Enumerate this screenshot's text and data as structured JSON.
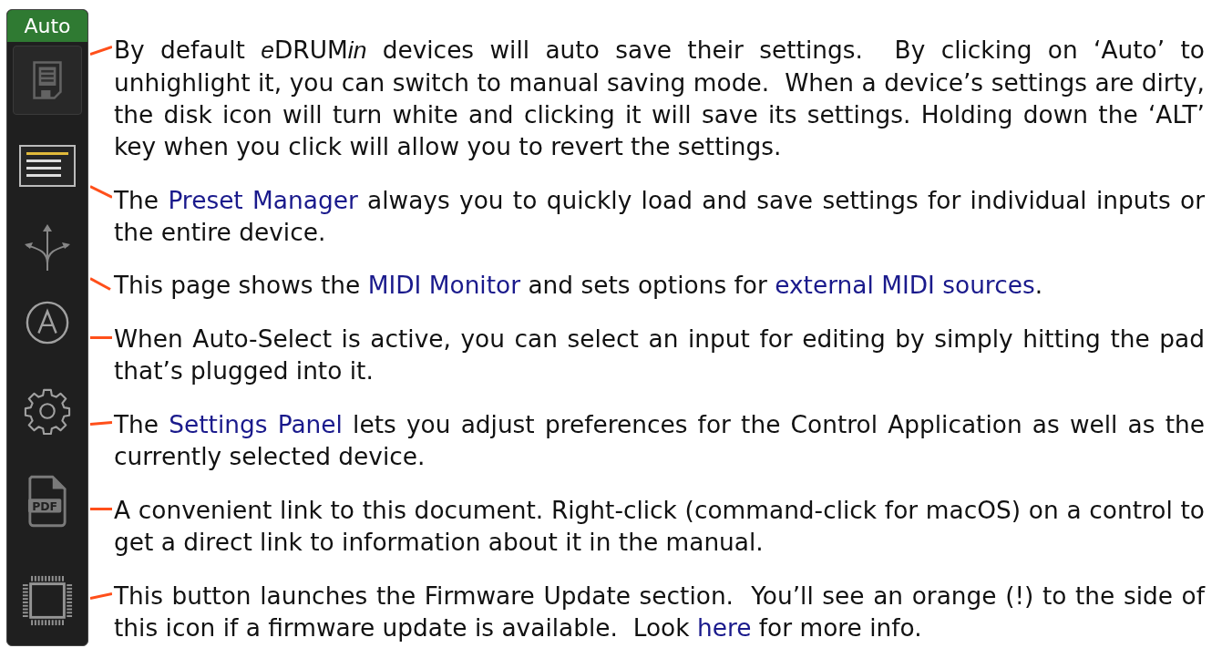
{
  "sidebar": {
    "auto_button": {
      "label": "Auto",
      "on": true
    },
    "buttons": [
      {
        "kind": "save",
        "selected": false
      },
      {
        "kind": "presets",
        "selected": true
      },
      {
        "kind": "routing",
        "selected": false
      },
      {
        "kind": "auto_select",
        "selected": false
      },
      {
        "kind": "settings",
        "selected": false
      },
      {
        "kind": "pdf",
        "selected": false,
        "label": "PDF"
      },
      {
        "kind": "firmware",
        "selected": false
      }
    ]
  },
  "descriptions": [
    {
      "segments": [
        {
          "kind": "text",
          "text": "By default "
        },
        {
          "kind": "italic",
          "text": "e"
        },
        {
          "kind": "text",
          "text": "DRUM"
        },
        {
          "kind": "italic",
          "text": "in"
        },
        {
          "kind": "text",
          "text": " devices will auto save their settings.  By clicking on ‘Auto’ to unhighlight it, you can switch to manual saving mode.  When a device’s settings are dirty, the disk icon will turn white and clicking it will save its settings. Holding down the ‘ALT’ key when you click will allow you to revert the settings."
        }
      ]
    },
    {
      "segments": [
        {
          "kind": "text",
          "text": "The "
        },
        {
          "kind": "link",
          "text": "Preset Manager"
        },
        {
          "kind": "text",
          "text": " always you to quickly load and save settings for individual inputs or the entire device."
        }
      ]
    },
    {
      "segments": [
        {
          "kind": "text",
          "text": "This page shows the "
        },
        {
          "kind": "link",
          "text": "MIDI Monitor"
        },
        {
          "kind": "text",
          "text": " and sets options for "
        },
        {
          "kind": "link",
          "text": "external MIDI sources"
        },
        {
          "kind": "text",
          "text": "."
        }
      ]
    },
    {
      "segments": [
        {
          "kind": "text",
          "text": "When Auto-Select is active, you can select an input for editing by simply hitting the pad that’s plugged into it."
        }
      ]
    },
    {
      "segments": [
        {
          "kind": "text",
          "text": "The "
        },
        {
          "kind": "link",
          "text": "Settings Panel"
        },
        {
          "kind": "text",
          "text": " lets you adjust preferences for the Control Application as well as the currently selected device."
        }
      ]
    },
    {
      "segments": [
        {
          "kind": "text",
          "text": "A convenient link to this document. Right-click (command-click for macOS) on a control to get a direct link to information about it in the manual."
        }
      ]
    },
    {
      "segments": [
        {
          "kind": "text",
          "text": "This button launches the Firmware Update section.  You’ll see an orange (!) to the side of this icon if a firmware update is available.  Look "
        },
        {
          "kind": "link",
          "text": "here"
        },
        {
          "kind": "text",
          "text": " for more info."
        }
      ]
    }
  ]
}
